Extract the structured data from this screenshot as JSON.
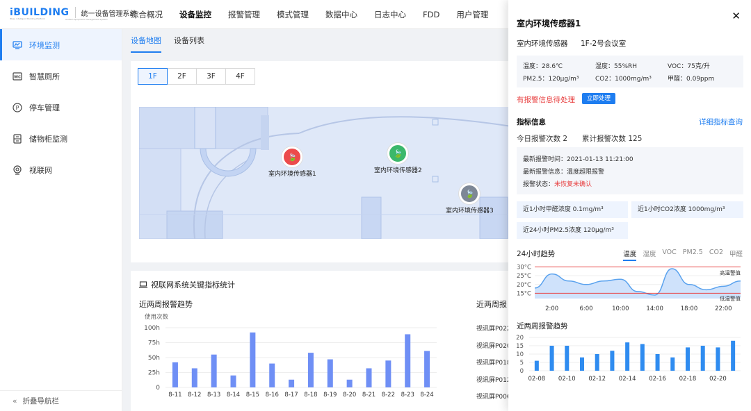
{
  "header": {
    "logo_text": "iBUILDING",
    "logo_sub": "iBase intelligent Building Platform",
    "system_name": "统一设备管理系统",
    "system_en": "Unified equipment management system",
    "nav": [
      {
        "label": "综合概况",
        "active": false
      },
      {
        "label": "设备监控",
        "active": true
      },
      {
        "label": "报警管理",
        "active": false
      },
      {
        "label": "模式管理",
        "active": false
      },
      {
        "label": "数据中心",
        "active": false
      },
      {
        "label": "日志中心",
        "active": false
      },
      {
        "label": "FDD",
        "active": false
      },
      {
        "label": "用户管理",
        "active": false
      }
    ]
  },
  "sidebar": {
    "items": [
      {
        "label": "环境监测",
        "icon": "monitor-chart-icon",
        "active": true
      },
      {
        "label": "智慧厕所",
        "icon": "wc-icon",
        "active": false
      },
      {
        "label": "停车管理",
        "icon": "parking-icon",
        "active": false
      },
      {
        "label": "储物柜监测",
        "icon": "locker-icon",
        "active": false
      },
      {
        "label": "视联网",
        "icon": "camera-icon",
        "active": false
      }
    ],
    "collapse_label": "折叠导航栏"
  },
  "tabs": [
    {
      "label": "设备地图",
      "active": true
    },
    {
      "label": "设备列表",
      "active": false
    }
  ],
  "map": {
    "floors": [
      {
        "label": "1F",
        "active": true
      },
      {
        "label": "2F",
        "active": false
      },
      {
        "label": "3F",
        "active": false
      },
      {
        "label": "4F",
        "active": false
      }
    ],
    "markers": [
      {
        "label": "室内环境传感器1",
        "color": "#ec4b4b"
      },
      {
        "label": "室内环境传感器2",
        "color": "#3bb86b"
      },
      {
        "label": "室内环境传感器3",
        "color": "#7d8796"
      }
    ]
  },
  "stats": {
    "title": "视联网系统关键指标统计",
    "weekly_title": "近两周报警趋势",
    "unit_label": "使用次数",
    "right_title": "近两周报",
    "right_list": [
      "视讯屏P022",
      "视讯屏P020",
      "视讯屏P018",
      "视讯屏P012",
      "视讯屏P006"
    ]
  },
  "chart_data": [
    {
      "type": "bar",
      "title": "近两周报警趋势",
      "ylabel": "使用次数",
      "categories": [
        "8-11",
        "8-12",
        "8-13",
        "8-14",
        "8-15",
        "8-16",
        "8-17",
        "8-18",
        "8-19",
        "8-20",
        "8-21",
        "8-22",
        "8-23",
        "8-24"
      ],
      "values": [
        42,
        32,
        55,
        20,
        92,
        40,
        13,
        58,
        47,
        13,
        32,
        45,
        89,
        61
      ],
      "yticks": [
        "0",
        "25h",
        "50h",
        "75h",
        "100h"
      ],
      "ylim": [
        0,
        100
      ],
      "color": "#6f8ff5"
    },
    {
      "type": "area",
      "title": "24小时趋势",
      "x": [
        "2:00",
        "6:00",
        "10:00",
        "14:00",
        "18:00",
        "22:00"
      ],
      "yticks": [
        "15°C",
        "20°C",
        "25°C",
        "30°C"
      ],
      "ylim": [
        12,
        31
      ],
      "thresholds": [
        {
          "label": "高温警值",
          "value": 30
        },
        {
          "label": "低温警值",
          "value": 15
        }
      ],
      "points": [
        [
          0,
          18
        ],
        [
          2,
          26
        ],
        [
          4,
          22
        ],
        [
          6,
          20
        ],
        [
          8,
          22
        ],
        [
          10,
          23
        ],
        [
          12,
          16
        ],
        [
          14,
          14
        ],
        [
          16,
          29
        ],
        [
          18,
          20
        ],
        [
          20,
          17
        ],
        [
          22,
          19
        ],
        [
          24,
          22
        ]
      ],
      "color": "#5aa2ee"
    },
    {
      "type": "bar",
      "title": "近两周报警趋势",
      "categories": [
        "02-08",
        "02-09",
        "02-10",
        "02-11",
        "02-12",
        "02-13",
        "02-14",
        "02-15",
        "02-16",
        "02-17",
        "02-18",
        "02-19",
        "02-20",
        "02-21"
      ],
      "xlabels": [
        "02-08",
        "02-10",
        "02-12",
        "02-14",
        "02-16",
        "02-18",
        "02-20"
      ],
      "values": [
        6,
        15,
        15,
        8,
        10,
        12,
        17,
        16,
        10,
        8,
        14,
        15,
        14,
        18
      ],
      "yticks": [
        "0",
        "5",
        "10",
        "15",
        "20"
      ],
      "ylim": [
        0,
        20
      ],
      "color": "#2f8cf0"
    }
  ],
  "panel": {
    "title": "室内环境传感器1",
    "device_name": "室内环境传感器",
    "location": "1F-2号会议室",
    "readings": [
      {
        "label": "温度：28.6℃"
      },
      {
        "label": "湿度：55%RH"
      },
      {
        "label": "VOC：75克/升"
      },
      {
        "label": "PM2.5：120μg/m³"
      },
      {
        "label": "CO2：1000mg/m³"
      },
      {
        "label": "甲醛：0.09ppm"
      }
    ],
    "alert_text": "有报警信息待处理",
    "alert_button": "立即处理",
    "indicators_title": "指标信息",
    "detail_link": "详细指标查询",
    "today_alarms": "今日报警次数  2",
    "total_alarms": "累计报警次数  125",
    "last_time": "最新报警时间：2021-01-13  11:21:00",
    "last_info": "最新报警信息：温度超限报警",
    "status_label": "报警状态：",
    "status_value": "未恢复未确认",
    "chips": [
      "近1小时甲醛浓度  0.1mg/m³",
      "近1小时CO2浓度  1000mg/m³",
      "近24小时PM2.5浓度  120μg/m³"
    ],
    "trend_title": "24小时趋势",
    "trend_tabs": [
      {
        "label": "温度",
        "active": true
      },
      {
        "label": "湿度",
        "active": false
      },
      {
        "label": "VOC",
        "active": false
      },
      {
        "label": "PM2.5",
        "active": false
      },
      {
        "label": "CO2",
        "active": false
      },
      {
        "label": "甲醛",
        "active": false
      }
    ],
    "weekly_title": "近两周报警趋势"
  }
}
